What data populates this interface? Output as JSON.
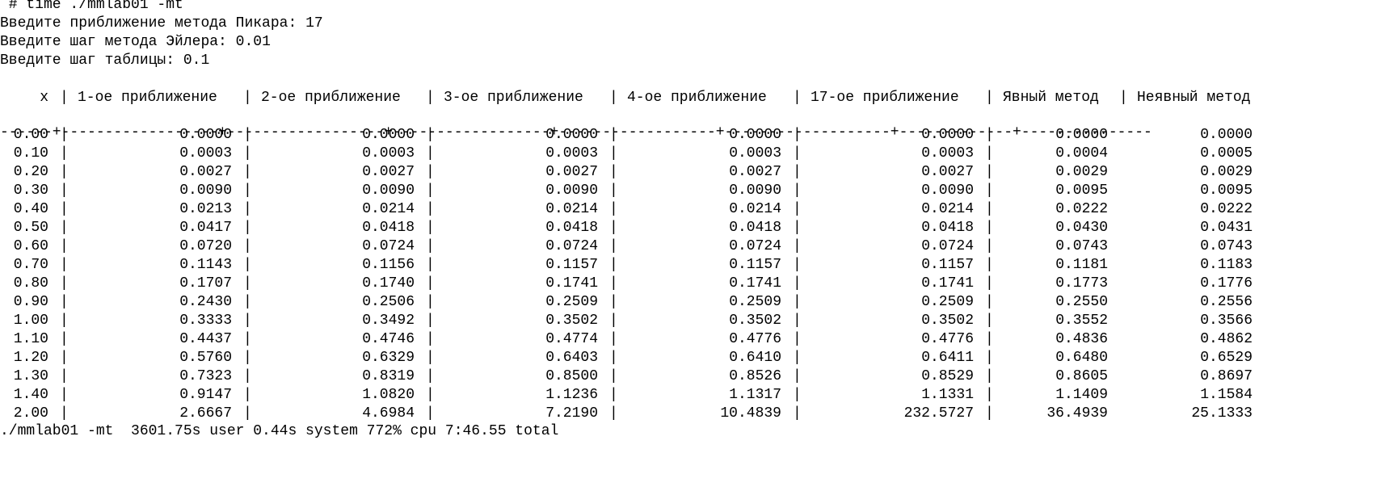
{
  "prompt": {
    "command": " # time ./mmlab01 -mt"
  },
  "inputs": [
    {
      "label": "Введите приближение метода Пикара:",
      "value": "17"
    },
    {
      "label": "Введите шаг метода Эйлера:",
      "value": "0.01"
    },
    {
      "label": "Введите шаг таблицы:",
      "value": "0.1"
    }
  ],
  "table": {
    "headers": [
      "x",
      "1-ое приближение",
      "2-ое приближение",
      "3-ое приближение",
      "4-ое приближение",
      "17-ое приближение",
      "Явный метод",
      "Неявный метод"
    ],
    "divider": "------+------------------+------------------+------------------+------------------+-------------------+-------------+---------------",
    "rows": [
      [
        "0.00",
        "0.0000",
        "0.0000",
        "0.0000",
        "0.0000",
        "0.0000",
        "0.0000",
        "0.0000"
      ],
      [
        "0.10",
        "0.0003",
        "0.0003",
        "0.0003",
        "0.0003",
        "0.0003",
        "0.0004",
        "0.0005"
      ],
      [
        "0.20",
        "0.0027",
        "0.0027",
        "0.0027",
        "0.0027",
        "0.0027",
        "0.0029",
        "0.0029"
      ],
      [
        "0.30",
        "0.0090",
        "0.0090",
        "0.0090",
        "0.0090",
        "0.0090",
        "0.0095",
        "0.0095"
      ],
      [
        "0.40",
        "0.0213",
        "0.0214",
        "0.0214",
        "0.0214",
        "0.0214",
        "0.0222",
        "0.0222"
      ],
      [
        "0.50",
        "0.0417",
        "0.0418",
        "0.0418",
        "0.0418",
        "0.0418",
        "0.0430",
        "0.0431"
      ],
      [
        "0.60",
        "0.0720",
        "0.0724",
        "0.0724",
        "0.0724",
        "0.0724",
        "0.0743",
        "0.0743"
      ],
      [
        "0.70",
        "0.1143",
        "0.1156",
        "0.1157",
        "0.1157",
        "0.1157",
        "0.1181",
        "0.1183"
      ],
      [
        "0.80",
        "0.1707",
        "0.1740",
        "0.1741",
        "0.1741",
        "0.1741",
        "0.1773",
        "0.1776"
      ],
      [
        "0.90",
        "0.2430",
        "0.2506",
        "0.2509",
        "0.2509",
        "0.2509",
        "0.2550",
        "0.2556"
      ],
      [
        "1.00",
        "0.3333",
        "0.3492",
        "0.3502",
        "0.3502",
        "0.3502",
        "0.3552",
        "0.3566"
      ],
      [
        "1.10",
        "0.4437",
        "0.4746",
        "0.4774",
        "0.4776",
        "0.4776",
        "0.4836",
        "0.4862"
      ],
      [
        "1.20",
        "0.5760",
        "0.6329",
        "0.6403",
        "0.6410",
        "0.6411",
        "0.6480",
        "0.6529"
      ],
      [
        "1.30",
        "0.7323",
        "0.8319",
        "0.8500",
        "0.8526",
        "0.8529",
        "0.8605",
        "0.8697"
      ],
      [
        "1.40",
        "0.9147",
        "1.0820",
        "1.1236",
        "1.1317",
        "1.1331",
        "1.1409",
        "1.1584"
      ],
      [
        "2.00",
        "2.6667",
        "4.6984",
        "7.2190",
        "10.4839",
        "232.5727",
        "36.4939",
        "25.1333"
      ]
    ]
  },
  "summary": "./mmlab01 -mt  3601.75s user 0.44s system 772% cpu 7:46.55 total"
}
